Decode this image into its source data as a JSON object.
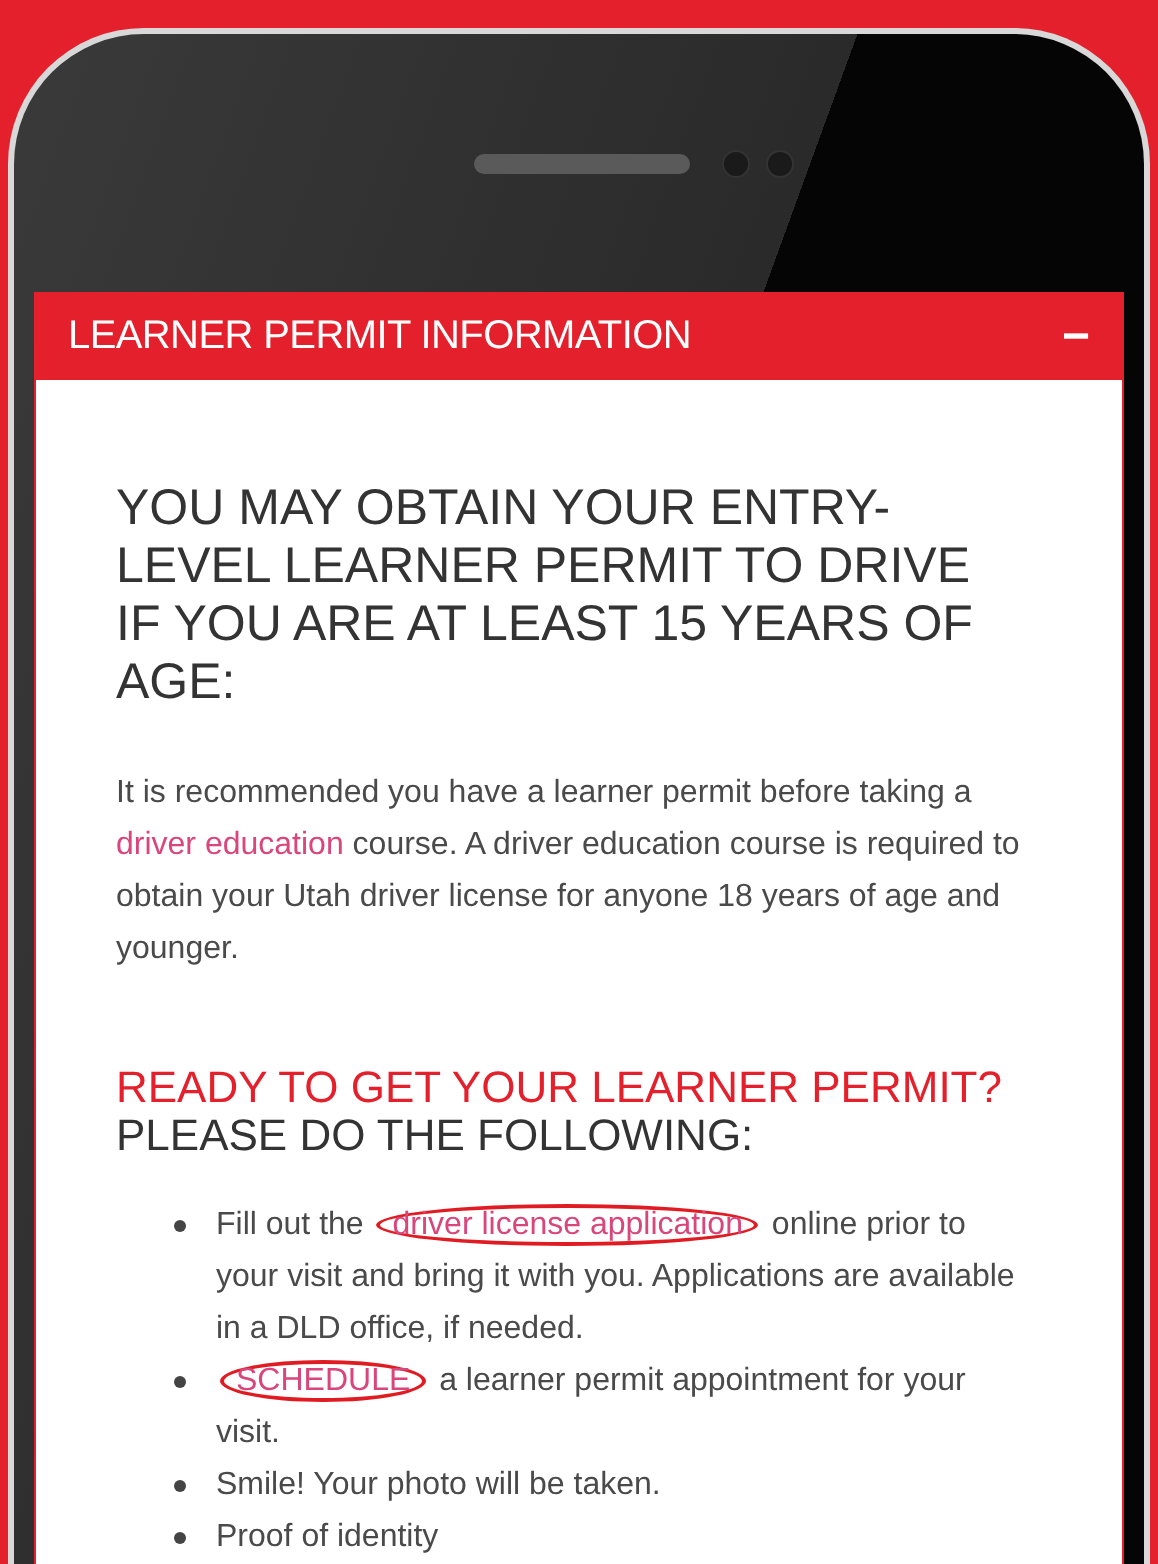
{
  "panel": {
    "title": "LEARNER PERMIT INFORMATION",
    "collapse_symbol": "−",
    "expanded": true
  },
  "heading": "YOU MAY OBTAIN YOUR ENTRY-LEVEL LEARNER PERMIT TO DRIVE IF YOU ARE AT LEAST 15 YEARS OF AGE:",
  "paragraph": [
    {
      "kind": "text",
      "text": "It is recommended you have a learner permit before taking a "
    },
    {
      "kind": "link",
      "circled": false,
      "text": "driver education"
    },
    {
      "kind": "text",
      "text": " course. A driver education course is required to obtain your Utah driver license for anyone 18 years of age and younger."
    }
  ],
  "subheading": [
    {
      "kind": "accent",
      "text": "READY TO GET YOUR LEARNER PERMIT?"
    },
    {
      "kind": "plain",
      "text": " PLEASE DO THE FOLLOWING:"
    }
  ],
  "steps": [
    {
      "parts": [
        {
          "kind": "text",
          "text": "Fill out the "
        },
        {
          "kind": "link",
          "circled": true,
          "text": "driver license application"
        },
        {
          "kind": "text",
          "text": " online prior to your visit and bring it with you. Applications are available in a DLD office, if needed."
        }
      ]
    },
    {
      "parts": [
        {
          "kind": "link",
          "circled": true,
          "text": "SCHEDULE"
        },
        {
          "kind": "text",
          "text": " a learner permit appointment for your visit."
        }
      ]
    },
    {
      "parts": [
        {
          "kind": "text",
          "text": "Smile! Your photo will be taken."
        }
      ]
    },
    {
      "parts": [
        {
          "kind": "text",
          "text": "Proof of identity"
        }
      ]
    }
  ]
}
